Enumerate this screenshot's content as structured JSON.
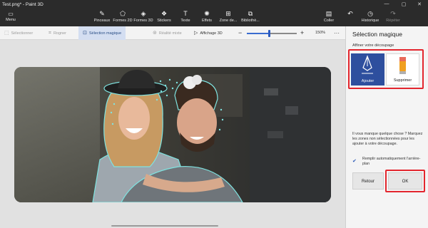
{
  "window": {
    "title": "Test.png* - Paint 3D",
    "controls": [
      "—",
      "▢",
      "✕"
    ]
  },
  "ribbon": {
    "menu": {
      "icon": "folder-icon",
      "label": "Menu"
    },
    "tools": [
      {
        "icon": "brush-icon",
        "label": "Pinceaux"
      },
      {
        "icon": "shapes-2d-icon",
        "label": "Formes 2D"
      },
      {
        "icon": "cube-icon",
        "label": "Formes 3D"
      },
      {
        "icon": "sticker-icon",
        "label": "Stickers"
      },
      {
        "icon": "text-icon",
        "label": "Texte"
      },
      {
        "icon": "effects-icon",
        "label": "Effets"
      },
      {
        "icon": "canvas-icon",
        "label": "Zone de..."
      },
      {
        "icon": "library-icon",
        "label": "Bibliothè..."
      }
    ],
    "right": [
      {
        "icon": "paste-icon",
        "label": "Coller"
      },
      {
        "icon": "undo-icon",
        "label": ""
      },
      {
        "icon": "history-icon",
        "label": "Historique"
      },
      {
        "icon": "redo-icon",
        "label": "Répéter"
      }
    ]
  },
  "subbar": {
    "select": "Sélectionner",
    "crop": "Rogner",
    "magic_select": "Sélection magique",
    "mixed_reality": "Réalité mixte",
    "view_3d": "Affichage 3D",
    "zoom_minus": "−",
    "zoom_plus": "+",
    "zoom_value": "150%",
    "zoom_fraction": 0.45,
    "more": "···"
  },
  "panel": {
    "title": "Sélection magique",
    "label": "Affiner votre découpage",
    "add_label": "Ajouter",
    "remove_label": "Supprimer",
    "help_text": "Il vous manque quelque chose ? Marquez les zones non sélectionnées pour les ajouter à votre découpage.",
    "autofill_text": "Remplir automatiquement l'arrière-plan",
    "autofill_checked": true,
    "back_label": "Retour",
    "ok_label": "OK"
  },
  "colors": {
    "ribbon_bg": "#2b2b2b",
    "accent": "#2e4f9e",
    "highlight_red": "#e3262e"
  }
}
